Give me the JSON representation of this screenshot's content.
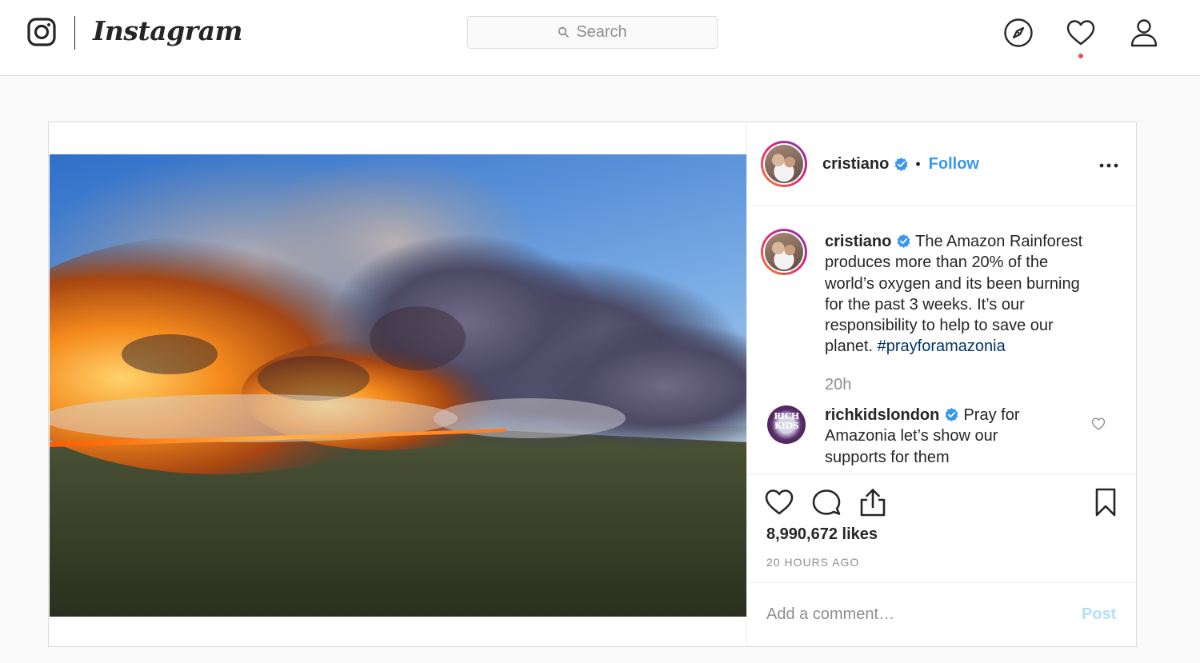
{
  "nav": {
    "wordmark": "Instagram",
    "search_placeholder": "Search",
    "icons": [
      "instagram-glyph",
      "compass-icon",
      "heart-icon",
      "profile-icon"
    ],
    "has_notification": true,
    "notification_color": "#ed4956"
  },
  "post": {
    "username": "cristiano",
    "verified": true,
    "separator": "•",
    "follow_label": "Follow",
    "caption_username": "cristiano",
    "caption_text": "The Amazon Rainforest produces more than 20% of the world’s oxygen and its been burning for the past 3 weeks. It’s our responsibility to help to save our planet.",
    "hashtag": "#prayforamazonia",
    "caption_age": "20h",
    "comment": {
      "username": "richkidslondon",
      "verified": true,
      "text": "Pray for Amazonia let’s show our supports for them",
      "avatar_text": "RICH KIDS"
    },
    "likes": "8,990,672 likes",
    "posted_ago": "20 HOURS AGO",
    "comment_placeholder": "Add a comment…",
    "post_label": "Post"
  },
  "colors": {
    "link_blue": "#3897f0",
    "hashtag_blue": "#003569",
    "post_disabled": "#b2dffc",
    "muted": "#8e8e8e",
    "border": "#dbdbdb"
  }
}
